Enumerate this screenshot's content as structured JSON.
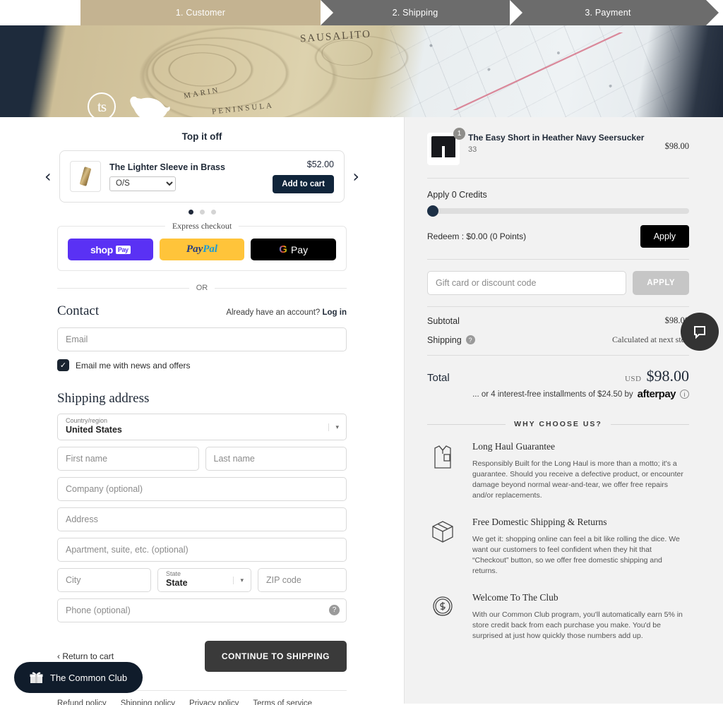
{
  "steps": [
    {
      "label": "1. Customer",
      "state": "active"
    },
    {
      "label": "2. Shipping",
      "state": "inactive"
    },
    {
      "label": "3. Payment",
      "state": "inactive"
    }
  ],
  "banner": {
    "brand_mark": "ts",
    "map_labels": [
      "SAUSALITO",
      "MARIN",
      "PENINSULA"
    ]
  },
  "upsell": {
    "title": "Top it off",
    "product_name": "The Lighter Sleeve in Brass",
    "variant_selected": "O/S",
    "variant_options": [
      "O/S"
    ],
    "price": "$52.00",
    "add_to_cart": "Add to cart",
    "prev_arrow": "‹",
    "next_arrow": "›",
    "dots": 3,
    "active_dot": 0
  },
  "express": {
    "legend": "Express checkout",
    "shop_pay": "shop",
    "shop_pay_tag": "Pay",
    "paypal_pay": "Pay",
    "paypal_pal": "Pal",
    "gpay_g": "G",
    "gpay_label": "Pay",
    "or": "OR"
  },
  "contact": {
    "title": "Contact",
    "account_prompt": "Already have an account?",
    "login_label": "Log in",
    "email_placeholder": "Email",
    "email_value": "",
    "newsletter_label": "Email me with news and offers",
    "newsletter_checked": true,
    "check_glyph": "✓"
  },
  "shipping_address": {
    "title": "Shipping address",
    "country_label": "Country/region",
    "country_value": "United States",
    "first_name_placeholder": "First name",
    "last_name_placeholder": "Last name",
    "company_placeholder": "Company (optional)",
    "address_placeholder": "Address",
    "apartment_placeholder": "Apartment, suite, etc. (optional)",
    "city_placeholder": "City",
    "state_label": "State",
    "state_value": "State",
    "zip_placeholder": "ZIP code",
    "phone_placeholder": "Phone (optional)",
    "help_glyph": "?"
  },
  "actions": {
    "return_to_cart": "Return to cart",
    "return_arrow": "‹",
    "continue_label": "CONTINUE TO SHIPPING"
  },
  "footer_links": [
    "Refund policy",
    "Shipping policy",
    "Privacy policy",
    "Terms of service"
  ],
  "order": {
    "item": {
      "name": "The Easy Short in Heather Navy Seersucker",
      "variant": "33",
      "quantity": "1",
      "price": "$98.00"
    },
    "credits_label": "Apply 0 Credits",
    "slider_value": 0,
    "redeem_label": "Redeem : $0.00 (0 Points)",
    "redeem_apply": "Apply",
    "discount_placeholder": "Gift card or discount code",
    "discount_value": "",
    "discount_apply": "APPLY",
    "subtotal_label": "Subtotal",
    "subtotal_value": "$98.00",
    "shipping_label": "Shipping",
    "shipping_value": "Calculated at next step",
    "shipping_help_glyph": "?",
    "total_label": "Total",
    "total_currency": "USD",
    "total_value": "$98.00",
    "installments_text": "... or 4 interest-free installments of $24.50 by",
    "installments_brand": "afterpay",
    "installments_info": "ⓘ"
  },
  "why_choose": {
    "heading": "WHY CHOOSE US?",
    "items": [
      {
        "icon": "shirt-icon",
        "title": "Long Haul Guarantee",
        "text": "Responsibly Built for the Long Haul is more than a motto; it's a guarantee. Should you receive a defective product, or encounter damage beyond normal wear-and-tear, we offer free repairs and/or replacements."
      },
      {
        "icon": "box-icon",
        "title": "Free Domestic Shipping & Returns",
        "text": "We get it: shopping online can feel a bit like rolling the dice. We want our customers to feel confident when they hit that “Checkout” button, so we offer free domestic shipping and returns."
      },
      {
        "icon": "coin-icon",
        "title": "Welcome To The Club",
        "text": "With our Common Club program, you'll automatically earn 5% in store credit back from each purchase you make. You'd be surprised at just how quickly those numbers add up."
      }
    ]
  },
  "floating": {
    "club_label": "The Common Club",
    "chat_icon": "chat-icon"
  },
  "colors": {
    "step_active": "#c4b391",
    "step_inactive": "#6c6c6c",
    "accent_dark": "#10253b",
    "summary_bg": "#f2f2f2",
    "continue_btn": "#3a3a3a"
  }
}
